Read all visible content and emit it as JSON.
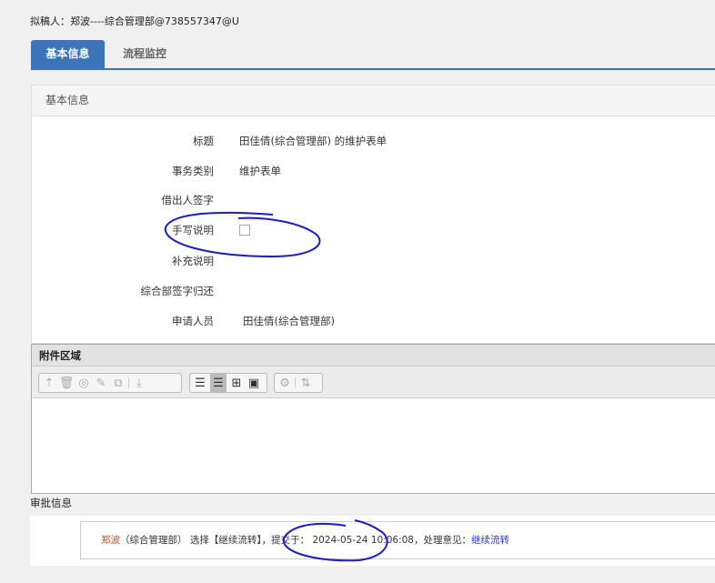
{
  "drafter": "拟稿人：郑波----综合管理部@738557347@U",
  "tabs": [
    {
      "label": "基本信息",
      "active": true
    },
    {
      "label": "流程监控",
      "active": false
    }
  ],
  "panel": {
    "title": "基本信息",
    "fields": [
      {
        "label": "标题",
        "value": "田佳倩(综合管理部) 的维护表单"
      },
      {
        "label": "事务类别",
        "value": "维护表单"
      },
      {
        "label": "借出人签字",
        "value": ""
      },
      {
        "label": "手写说明",
        "value": "",
        "image": "broken-image"
      },
      {
        "label": "补充说明",
        "value": ""
      },
      {
        "label": "综合部签字归还",
        "value": ""
      },
      {
        "label": "申请人员",
        "value": "田佳倩(综合管理部)"
      }
    ]
  },
  "attachments": {
    "title": "附件区域",
    "toolbar": [
      "upload-icon",
      "delete-icon",
      "preview-icon",
      "edit-icon",
      "copy-icon",
      "download-icon",
      "list-view-icon",
      "detail-view-icon",
      "grid-view-icon",
      "thumbnail-view-icon",
      "settings-icon",
      "sort-icon"
    ]
  },
  "approval": {
    "title": "审批信息",
    "name": "郑波",
    "dept": "（综合管理部）",
    "action": "选择【继续流转】，提交于：",
    "time": "2024-05-24 10:06:08",
    "sep": "，处理意见：",
    "opinion": "继续流转"
  },
  "colors": {
    "accent": "#3d74b8",
    "name": "#e0452b",
    "opinion": "#2a36d6",
    "annotation": "#1a1ad0"
  }
}
